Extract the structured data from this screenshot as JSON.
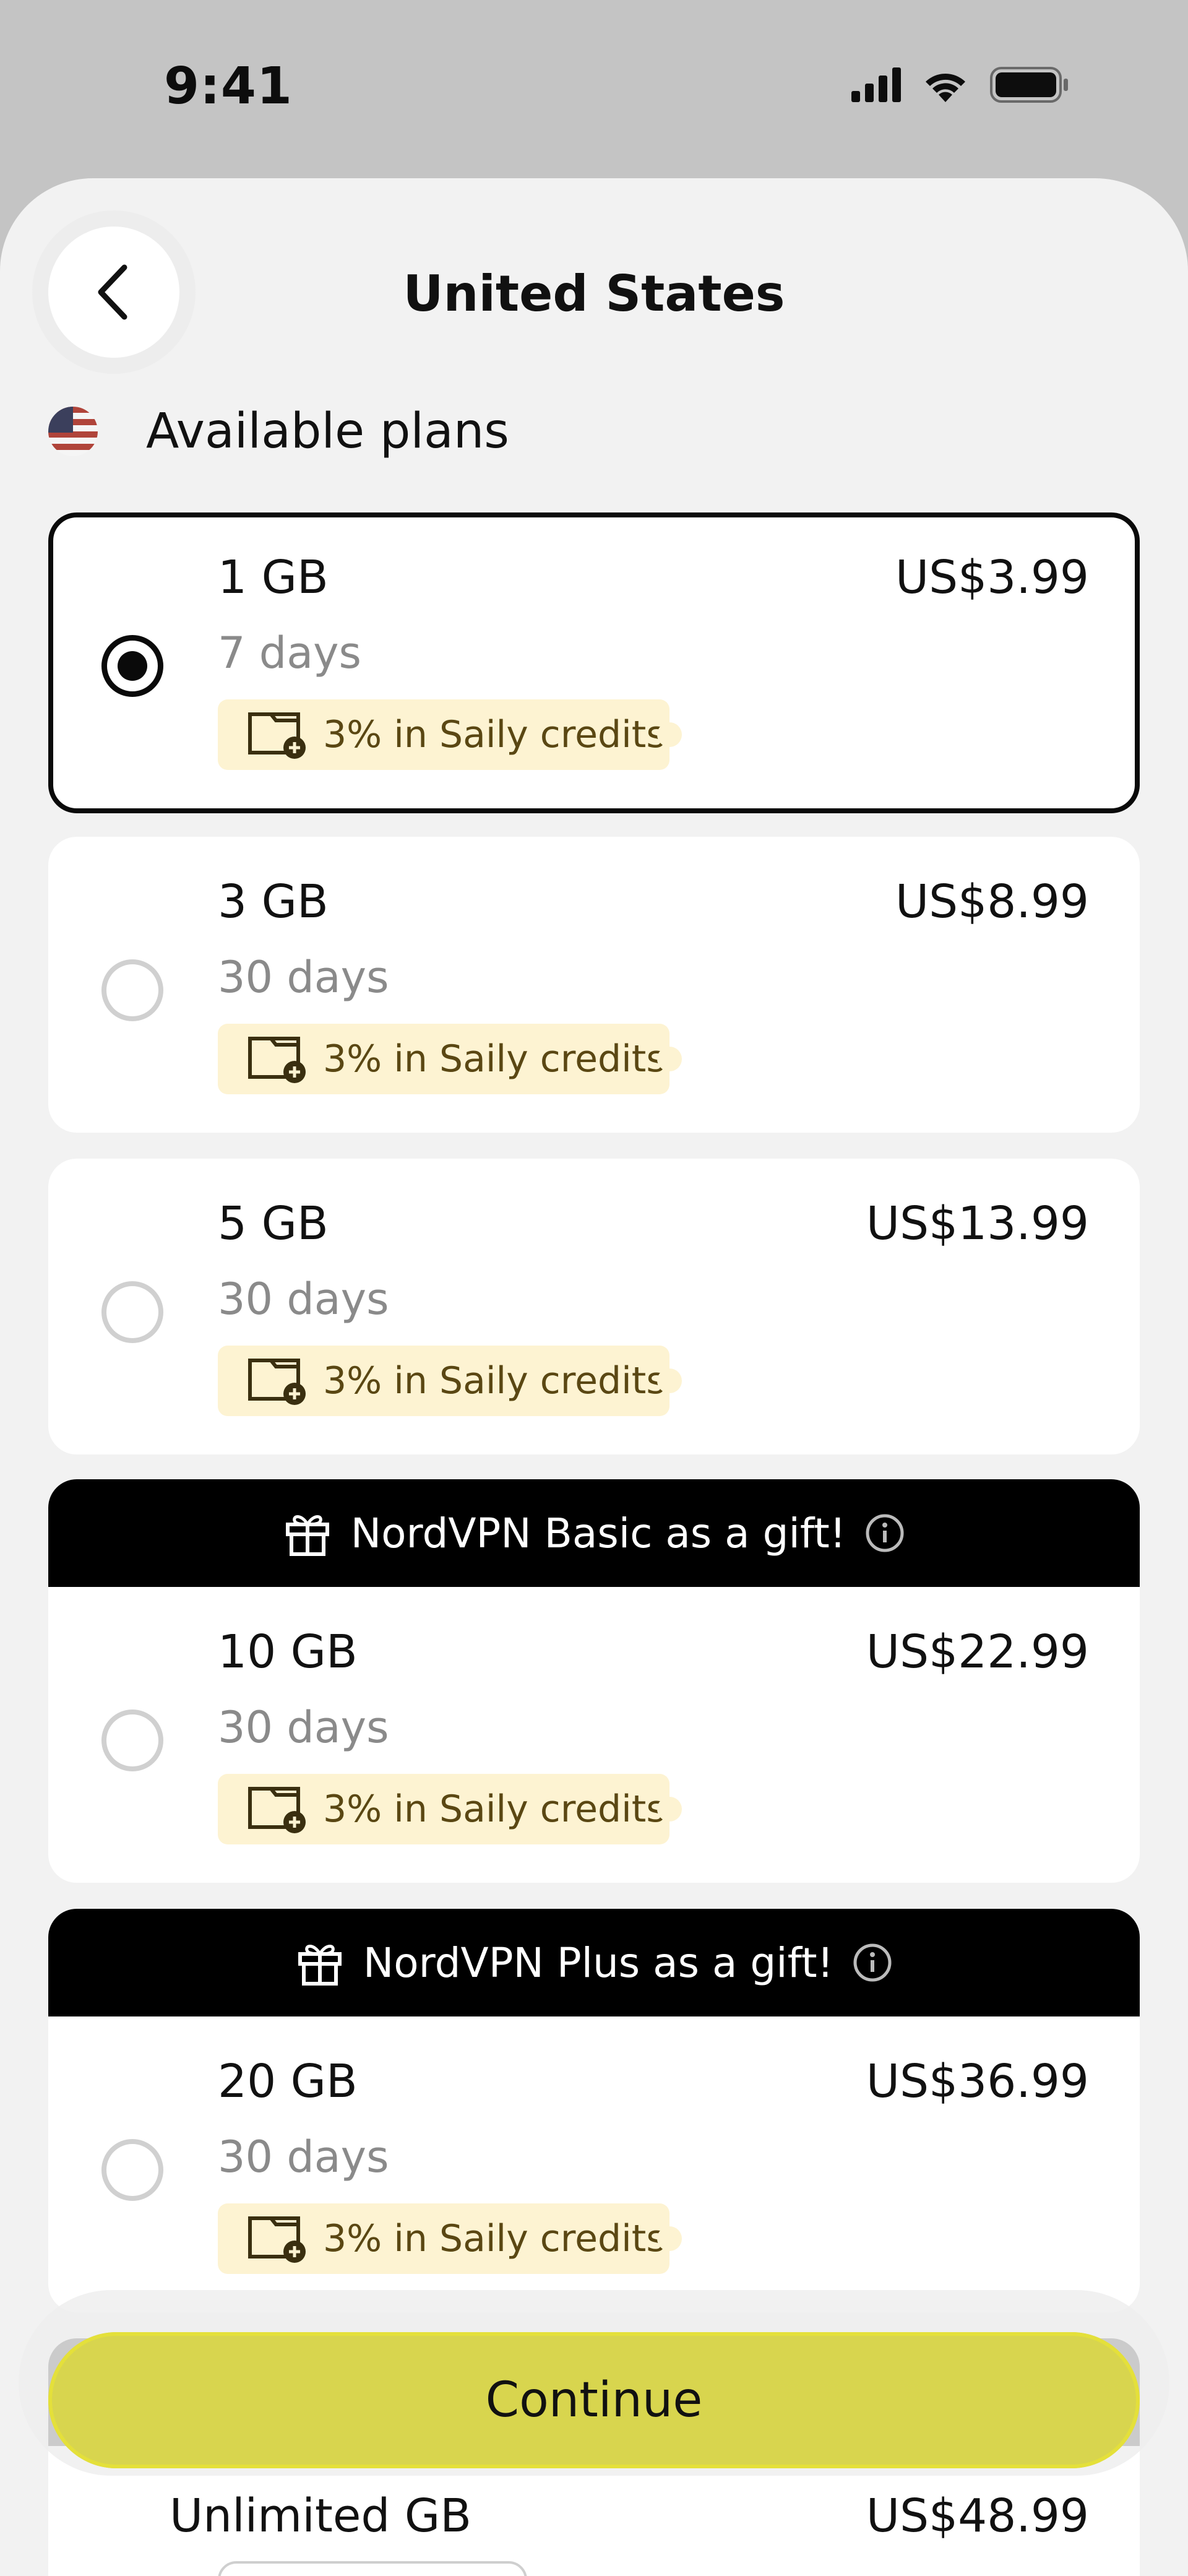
{
  "status_bar": {
    "time": "9:41"
  },
  "header": {
    "title": "United States"
  },
  "plans_section": {
    "label": "Available plans"
  },
  "plans": [
    {
      "gb": "1 GB",
      "price": "US$3.99",
      "days": "7 days",
      "credits": "3% in Saily credits",
      "selected": true
    },
    {
      "gb": "3 GB",
      "price": "US$8.99",
      "days": "30 days",
      "credits": "3% in Saily credits",
      "selected": false
    },
    {
      "gb": "5 GB",
      "price": "US$13.99",
      "days": "30 days",
      "credits": "3% in Saily credits",
      "selected": false
    },
    {
      "gift": "NordVPN Basic as a gift!",
      "gb": "10 GB",
      "price": "US$22.99",
      "days": "30 days",
      "credits": "3% in Saily credits",
      "selected": false
    },
    {
      "gift": "NordVPN Plus as a gift!",
      "gb": "20 GB",
      "price": "US$36.99",
      "days": "30 days",
      "credits": "3% in Saily credits",
      "selected": false
    },
    {
      "gb": "Unlimited GB",
      "price": "US$48.99"
    }
  ],
  "actions": {
    "continue_label": "Continue"
  },
  "colors": {
    "accent": "#d8d54e",
    "badge_bg": "#fdf3d2",
    "badge_text": "#5a4713",
    "sheet_bg": "#f2f2f2"
  }
}
